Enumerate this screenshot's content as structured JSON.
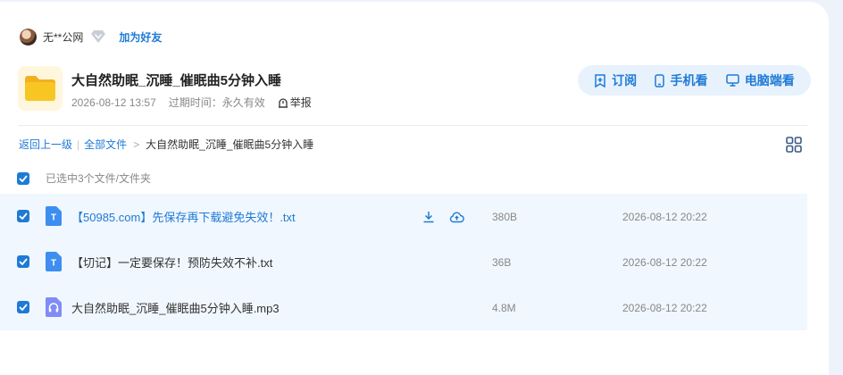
{
  "user": {
    "name": "无**公网",
    "add_friend": "加为好友"
  },
  "share": {
    "title": "大自然助眠_沉睡_催眠曲5分钟入睡",
    "date": "2026-08-12 13:57",
    "expire": "过期时间：永久有效",
    "report": "举报"
  },
  "actions": {
    "subscribe": "订阅",
    "mobile": "手机看",
    "desktop": "电脑端看"
  },
  "breadcrumb": {
    "back": "返回上一级",
    "all": "全部文件",
    "current": "大自然助眠_沉睡_催眠曲5分钟入睡"
  },
  "selection": {
    "text": "已选中3个文件/文件夹"
  },
  "files": [
    {
      "name": "【50985.com】先保存再下载避免失效！.txt",
      "size": "380B",
      "date": "2026-08-12 20:22",
      "type": "txt",
      "icon": "T"
    },
    {
      "name": "【切记】一定要保存！预防失效不补.txt",
      "size": "36B",
      "date": "2026-08-12 20:22",
      "type": "txt",
      "icon": "T"
    },
    {
      "name": "大自然助眠_沉睡_催眠曲5分钟入睡.mp3",
      "size": "4.8M",
      "date": "2026-08-12 20:22",
      "type": "audio",
      "icon": "headphones-icon"
    }
  ],
  "colors": {
    "accent": "#1f7ad6",
    "row_bg": "#f0f7fe",
    "action_bar_bg": "#e8f2fd",
    "folder": "#f8c623",
    "txt_icon": "#3d8ef0",
    "audio_icon": "#7f8cf7"
  }
}
